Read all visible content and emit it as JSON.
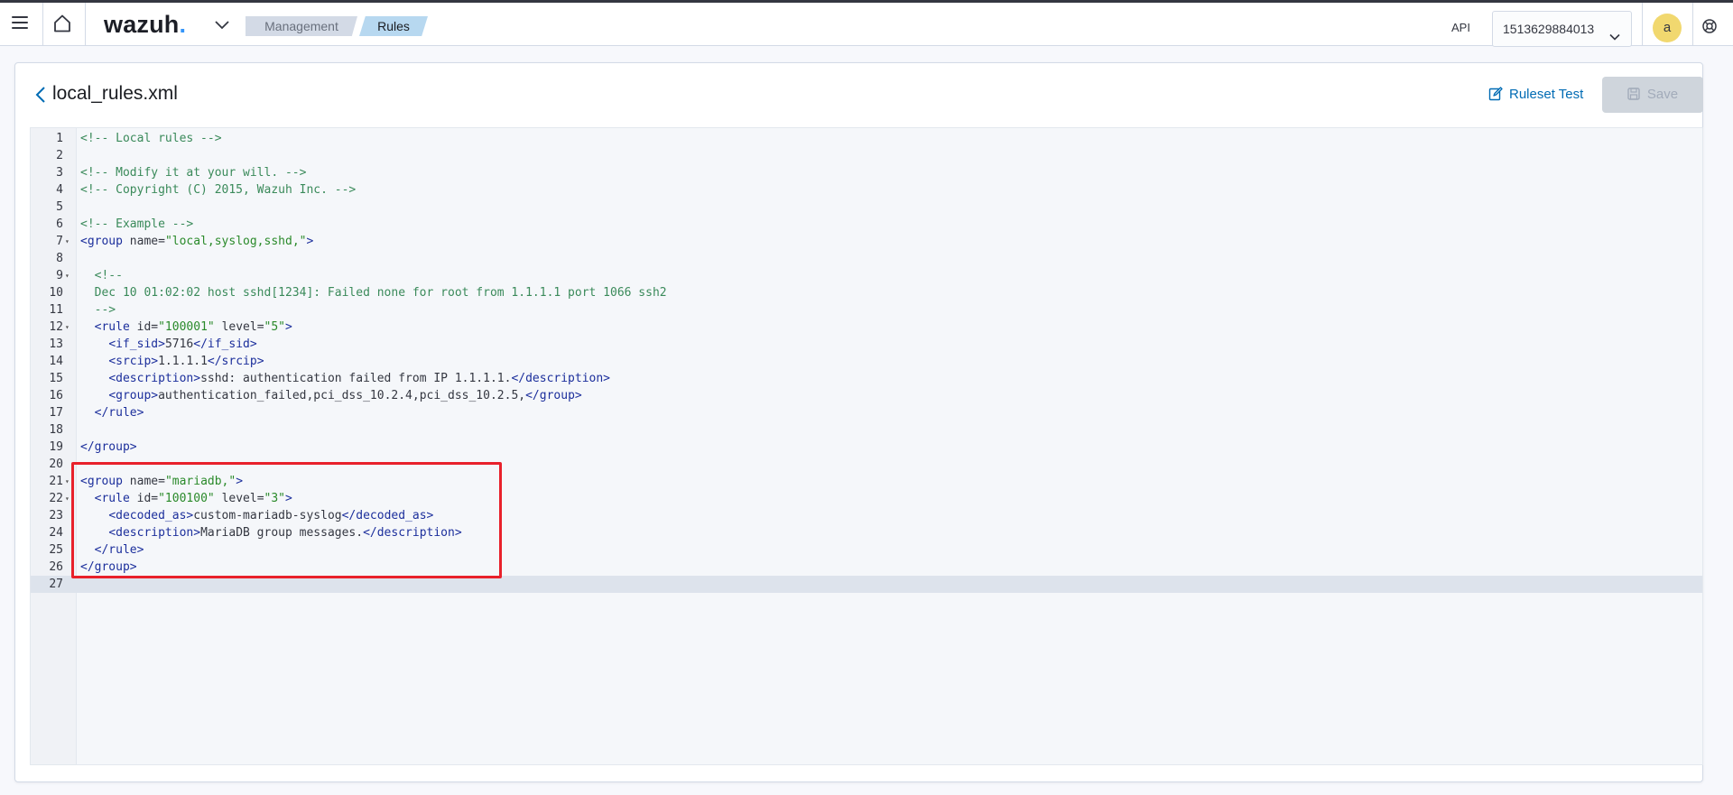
{
  "header": {
    "logo_text": "wazuh",
    "logo_dot": ".",
    "breadcrumb": [
      "Management",
      "Rules"
    ],
    "api_label": "API",
    "api_value": "1513629884013",
    "avatar_letter": "a"
  },
  "panel": {
    "title": "local_rules.xml",
    "ruleset_test_label": "Ruleset Test",
    "save_label": "Save"
  },
  "editor": {
    "lines": [
      {
        "n": "1",
        "fold": "",
        "html": "<span class=\"t-comment\">&lt;!-- Local rules --&gt;</span>"
      },
      {
        "n": "2",
        "fold": "",
        "html": ""
      },
      {
        "n": "3",
        "fold": "",
        "html": "<span class=\"t-comment\">&lt;!-- Modify it at your will. --&gt;</span>"
      },
      {
        "n": "4",
        "fold": "",
        "html": "<span class=\"t-comment\">&lt;!-- Copyright (C) 2015, Wazuh Inc. --&gt;</span>"
      },
      {
        "n": "5",
        "fold": "",
        "html": ""
      },
      {
        "n": "6",
        "fold": "",
        "html": "<span class=\"t-comment\">&lt;!-- Example --&gt;</span>"
      },
      {
        "n": "7",
        "fold": "▾",
        "html": "<span class=\"t-tag\">&lt;group</span> <span class=\"t-attr\">name=</span><span class=\"t-str\">\"local,syslog,sshd,\"</span><span class=\"t-tag\">&gt;</span>"
      },
      {
        "n": "8",
        "fold": "",
        "html": ""
      },
      {
        "n": "9",
        "fold": "▾",
        "html": "  <span class=\"t-comment\">&lt;!--</span>"
      },
      {
        "n": "10",
        "fold": "",
        "html": "  <span class=\"t-comment\">Dec 10 01:02:02 host sshd[1234]: Failed none for root from 1.1.1.1 port 1066 ssh2</span>"
      },
      {
        "n": "11",
        "fold": "",
        "html": "  <span class=\"t-comment\">--&gt;</span>"
      },
      {
        "n": "12",
        "fold": "▾",
        "html": "  <span class=\"t-tag\">&lt;rule</span> <span class=\"t-attr\">id=</span><span class=\"t-str\">\"100001\"</span> <span class=\"t-attr\">level=</span><span class=\"t-str\">\"5\"</span><span class=\"t-tag\">&gt;</span>"
      },
      {
        "n": "13",
        "fold": "",
        "html": "    <span class=\"t-tag\">&lt;if_sid&gt;</span><span class=\"t-text\">5716</span><span class=\"t-tag\">&lt;/if_sid&gt;</span>"
      },
      {
        "n": "14",
        "fold": "",
        "html": "    <span class=\"t-tag\">&lt;srcip&gt;</span><span class=\"t-text\">1.1.1.1</span><span class=\"t-tag\">&lt;/srcip&gt;</span>"
      },
      {
        "n": "15",
        "fold": "",
        "html": "    <span class=\"t-tag\">&lt;description&gt;</span><span class=\"t-text\">sshd: authentication failed from IP 1.1.1.1.</span><span class=\"t-tag\">&lt;/description&gt;</span>"
      },
      {
        "n": "16",
        "fold": "",
        "html": "    <span class=\"t-tag\">&lt;group&gt;</span><span class=\"t-text\">authentication_failed,pci_dss_10.2.4,pci_dss_10.2.5,</span><span class=\"t-tag\">&lt;/group&gt;</span>"
      },
      {
        "n": "17",
        "fold": "",
        "html": "  <span class=\"t-tag\">&lt;/rule&gt;</span>"
      },
      {
        "n": "18",
        "fold": "",
        "html": ""
      },
      {
        "n": "19",
        "fold": "",
        "html": "<span class=\"t-tag\">&lt;/group&gt;</span>"
      },
      {
        "n": "20",
        "fold": "",
        "html": ""
      },
      {
        "n": "21",
        "fold": "▾",
        "html": "<span class=\"t-tag\">&lt;group</span> <span class=\"t-attr\">name=</span><span class=\"t-str\">\"mariadb,\"</span><span class=\"t-tag\">&gt;</span>"
      },
      {
        "n": "22",
        "fold": "▾",
        "html": "  <span class=\"t-tag\">&lt;rule</span> <span class=\"t-attr\">id=</span><span class=\"t-str\">\"100100\"</span> <span class=\"t-attr\">level=</span><span class=\"t-str\">\"3\"</span><span class=\"t-tag\">&gt;</span>"
      },
      {
        "n": "23",
        "fold": "",
        "html": "    <span class=\"t-tag\">&lt;decoded_as&gt;</span><span class=\"t-text\">custom-mariadb-syslog</span><span class=\"t-tag\">&lt;/decoded_as&gt;</span>"
      },
      {
        "n": "24",
        "fold": "",
        "html": "    <span class=\"t-tag\">&lt;description&gt;</span><span class=\"t-text\">MariaDB group messages.</span><span class=\"t-tag\">&lt;/description&gt;</span>"
      },
      {
        "n": "25",
        "fold": "",
        "html": "  <span class=\"t-tag\">&lt;/rule&gt;</span>"
      },
      {
        "n": "26",
        "fold": "",
        "html": "<span class=\"t-tag\">&lt;/group&gt;</span>"
      },
      {
        "n": "27",
        "fold": "",
        "html": "",
        "active": true
      }
    ]
  },
  "colors": {
    "accent": "#006bb4",
    "highlight_box": "#e8212b",
    "comment": "#3a8a5a",
    "tag": "#1c2f9c",
    "string": "#2a8a2a"
  },
  "icons": [
    "menu-icon",
    "home-icon",
    "chevron-down-icon",
    "help-icon",
    "arrow-left-icon",
    "edit-icon",
    "save-icon"
  ]
}
